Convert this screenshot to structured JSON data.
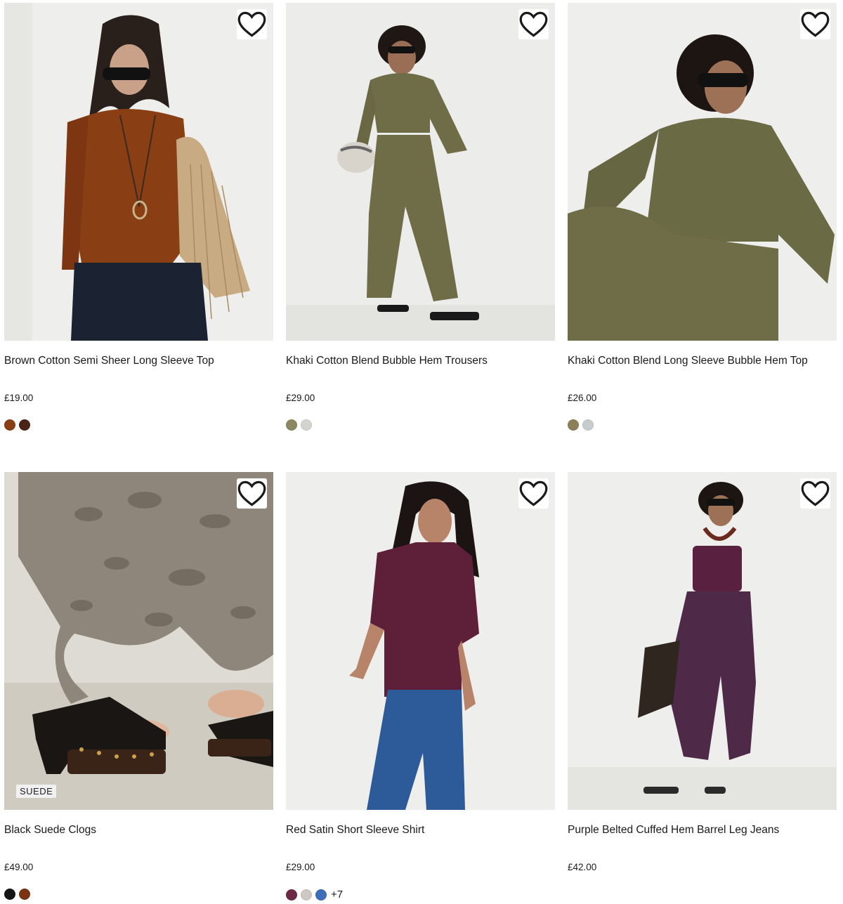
{
  "products": [
    {
      "title": "Brown Cotton Semi Sheer Long Sleeve Top",
      "price": "£19.00",
      "swatches": [
        "#8a3e14",
        "#4a2418"
      ],
      "more": "",
      "badge": ""
    },
    {
      "title": "Khaki Cotton Blend Bubble Hem Trousers",
      "price": "£29.00",
      "swatches": [
        "#8c8862",
        "#d3d3d0"
      ],
      "more": "",
      "badge": ""
    },
    {
      "title": "Khaki Cotton Blend Long Sleeve Bubble Hem Top",
      "price": "£26.00",
      "swatches": [
        "#8a7f58",
        "#c6ccce"
      ],
      "more": "",
      "badge": ""
    },
    {
      "title": "Black Suede Clogs",
      "price": "£49.00",
      "swatches": [
        "#151515",
        "#7a3414"
      ],
      "more": "",
      "badge": "SUEDE"
    },
    {
      "title": "Red Satin Short Sleeve Shirt",
      "price": "£29.00",
      "swatches": [
        "#6e2944",
        "#cfc8c2",
        "#3c6fb8"
      ],
      "more": "+7",
      "badge": ""
    },
    {
      "title": "Purple Belted Cuffed Hem Barrel Leg Jeans",
      "price": "£42.00",
      "swatches": [],
      "more": "",
      "badge": ""
    }
  ],
  "icons": {
    "wishlist": "heart-outline-icon"
  },
  "colors": {
    "text": "#1a1a1a",
    "card_bg": "#ecebe8"
  }
}
